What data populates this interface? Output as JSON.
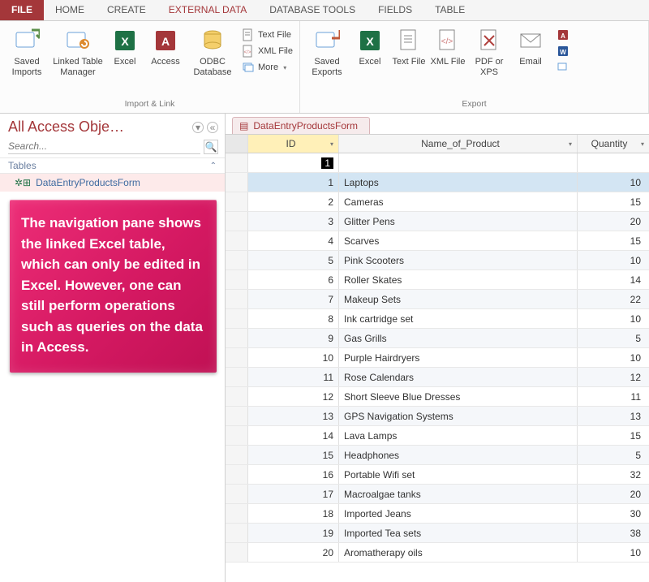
{
  "tabs": {
    "file": "FILE",
    "home": "HOME",
    "create": "CREATE",
    "external": "EXTERNAL DATA",
    "dbtools": "DATABASE TOOLS",
    "fields": "FIELDS",
    "table": "TABLE"
  },
  "ribbon": {
    "import_group": "Import & Link",
    "export_group": "Export",
    "saved_imports": "Saved Imports",
    "linked_table_manager": "Linked Table Manager",
    "excel": "Excel",
    "access": "Access",
    "odbc": "ODBC Database",
    "text_file": "Text File",
    "xml_file": "XML File",
    "more": "More",
    "saved_exports": "Saved Exports",
    "export_excel": "Excel",
    "export_text": "Text File",
    "export_xml": "XML File",
    "export_pdf": "PDF or XPS",
    "email": "Email"
  },
  "nav": {
    "title": "All Access Obje…",
    "search_placeholder": "Search...",
    "section_tables": "Tables",
    "item1": "DataEntryProductsForm"
  },
  "infobox_text": "The navigation pane shows the linked Excel table, which can only be edited in Excel. However, one can still perform operations such as queries on the data in Access.",
  "object_tab": "DataEntryProductsForm",
  "columns": {
    "id": "ID",
    "name": "Name_of_Product",
    "qty": "Quantity"
  },
  "new_row_id": "1",
  "rows": [
    {
      "id": 1,
      "name": "Laptops",
      "qty": 10
    },
    {
      "id": 2,
      "name": "Cameras",
      "qty": 15
    },
    {
      "id": 3,
      "name": "Glitter Pens",
      "qty": 20
    },
    {
      "id": 4,
      "name": "Scarves",
      "qty": 15
    },
    {
      "id": 5,
      "name": "Pink Scooters",
      "qty": 10
    },
    {
      "id": 6,
      "name": "Roller Skates",
      "qty": 14
    },
    {
      "id": 7,
      "name": "Makeup Sets",
      "qty": 22
    },
    {
      "id": 8,
      "name": "Ink cartridge set",
      "qty": 10
    },
    {
      "id": 9,
      "name": "Gas Grills",
      "qty": 5
    },
    {
      "id": 10,
      "name": "Purple Hairdryers",
      "qty": 10
    },
    {
      "id": 11,
      "name": "Rose Calendars",
      "qty": 12
    },
    {
      "id": 12,
      "name": "Short Sleeve Blue Dresses",
      "qty": 11
    },
    {
      "id": 13,
      "name": "GPS Navigation Systems",
      "qty": 13
    },
    {
      "id": 14,
      "name": "Lava Lamps",
      "qty": 15
    },
    {
      "id": 15,
      "name": "Headphones",
      "qty": 5
    },
    {
      "id": 16,
      "name": "Portable Wifi set",
      "qty": 32
    },
    {
      "id": 17,
      "name": "Macroalgae tanks",
      "qty": 20
    },
    {
      "id": 18,
      "name": "Imported Jeans",
      "qty": 30
    },
    {
      "id": 19,
      "name": "Imported Tea sets",
      "qty": 38
    },
    {
      "id": 20,
      "name": "Aromatherapy oils",
      "qty": 10
    }
  ]
}
